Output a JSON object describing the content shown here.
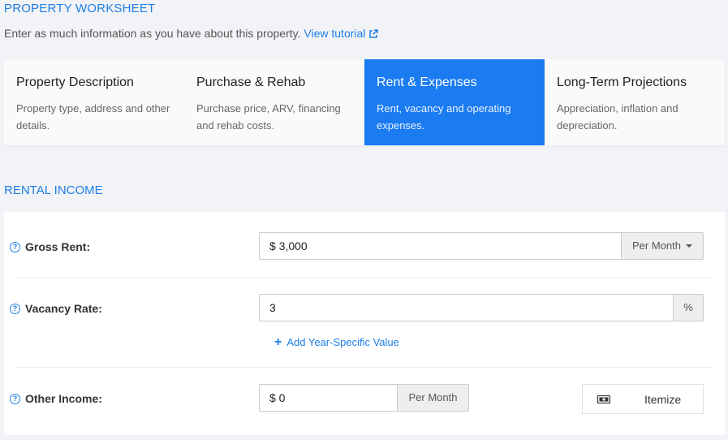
{
  "header": {
    "title": "PROPERTY WORKSHEET",
    "intro": "Enter as much information as you have about this property.",
    "tutorial_link": "View tutorial"
  },
  "tabs": [
    {
      "title": "Property Description",
      "desc": "Property type, address and other details.",
      "active": false
    },
    {
      "title": "Purchase & Rehab",
      "desc": "Purchase price, ARV, financing and rehab costs.",
      "active": false
    },
    {
      "title": "Rent & Expenses",
      "desc": "Rent, vacancy and operating expenses.",
      "active": true
    },
    {
      "title": "Long-Term Projections",
      "desc": "Appreciation, inflation and depreciation.",
      "active": false
    }
  ],
  "rental_income": {
    "section_title": "RENTAL INCOME",
    "gross_rent": {
      "label": "Gross Rent:",
      "value": "$ 3,000",
      "period": "Per Month"
    },
    "vacancy_rate": {
      "label": "Vacancy Rate:",
      "value": "3",
      "unit": "%",
      "add_link": "Add Year-Specific Value"
    },
    "other_income": {
      "label": "Other Income:",
      "value": "$ 0",
      "period": "Per Month",
      "itemize_label": "Itemize"
    }
  },
  "colors": {
    "accent": "#1e7ee6",
    "active_tab": "#1b7cf2",
    "background": "#f2f3f6"
  }
}
